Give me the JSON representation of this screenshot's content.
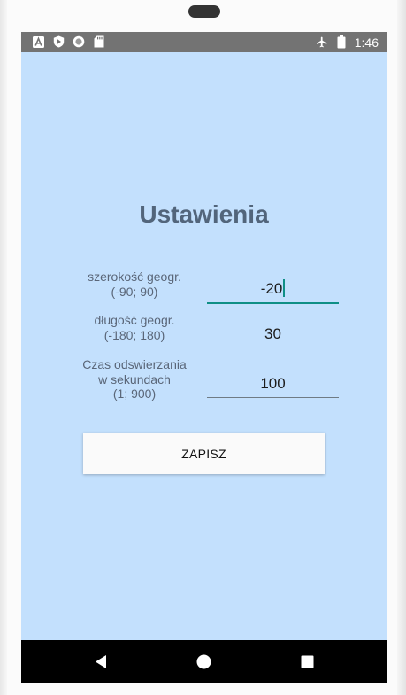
{
  "status_bar": {
    "time": "1:46",
    "left_icons": [
      "a-icon",
      "shield-play-icon",
      "circle-icon",
      "sd-card-icon"
    ],
    "right_icons": [
      "airplane-mode-icon",
      "battery-icon"
    ]
  },
  "page": {
    "title": "Ustawienia"
  },
  "fields": {
    "latitude": {
      "label_line1": "szerokość geogr.",
      "label_line2": "(-90; 90)",
      "value": "-20"
    },
    "longitude": {
      "label_line1": "długość geogr.",
      "label_line2": "(-180; 180)",
      "value": "30"
    },
    "refresh": {
      "label_line1": "Czas odswierzania",
      "label_line2": "w sekundach",
      "label_line3": "(1; 900)",
      "value": "100"
    }
  },
  "actions": {
    "save_label": "ZAPISZ"
  },
  "navigation": {
    "buttons": [
      "back-icon",
      "home-icon",
      "recents-icon"
    ]
  },
  "colors": {
    "screen_background": "#c3e0fd",
    "status_bar": "#737373",
    "title": "#52657b",
    "accent": "#0f8f86",
    "nav_bar": "#000000"
  }
}
